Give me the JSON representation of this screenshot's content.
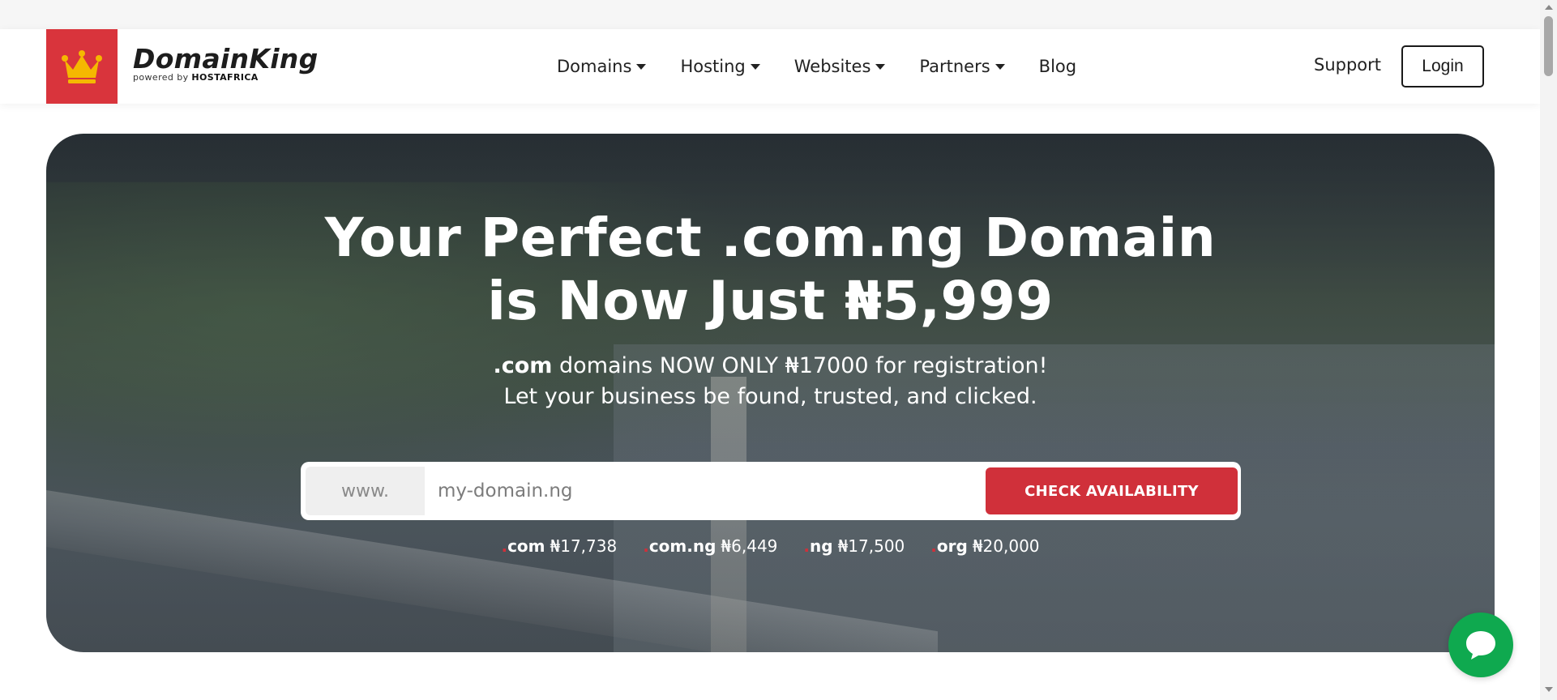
{
  "brand": {
    "name": "DomainKing",
    "powered_by": "powered by",
    "powered_by_company": "HOSTAFRICA"
  },
  "nav": {
    "items": [
      {
        "label": "Domains",
        "has_dropdown": true
      },
      {
        "label": "Hosting",
        "has_dropdown": true
      },
      {
        "label": "Websites",
        "has_dropdown": true
      },
      {
        "label": "Partners",
        "has_dropdown": true
      },
      {
        "label": "Blog",
        "has_dropdown": false
      }
    ],
    "support_label": "Support",
    "login_label": "Login"
  },
  "hero": {
    "title_line1": "Your Perfect .com.ng Domain",
    "title_line2": "is Now Just ₦5,999",
    "sub_bold": ".com",
    "sub_line1_rest": " domains NOW ONLY ₦17000 for registration!",
    "sub_line2": "Let your business be found, trusted, and clicked."
  },
  "search": {
    "prefix": "www.",
    "placeholder": "my-domain.ng",
    "button_label": "CHECK AVAILABILITY"
  },
  "tlds": [
    {
      "dot": ".",
      "ext": "com",
      "price": "₦17,738"
    },
    {
      "dot": ".",
      "ext": "com.ng",
      "price": "₦6,449"
    },
    {
      "dot": ".",
      "ext": "ng",
      "price": "₦17,500"
    },
    {
      "dot": ".",
      "ext": "org",
      "price": "₦20,000"
    }
  ],
  "colors": {
    "brand_red": "#d9343c",
    "button_red": "#d0303a",
    "chat_green": "#0fa94f",
    "crown_gold": "#f5b800"
  },
  "icons": {
    "logo": "crown-icon",
    "chat": "chat-bubble-icon",
    "dropdown": "caret-down-icon"
  }
}
